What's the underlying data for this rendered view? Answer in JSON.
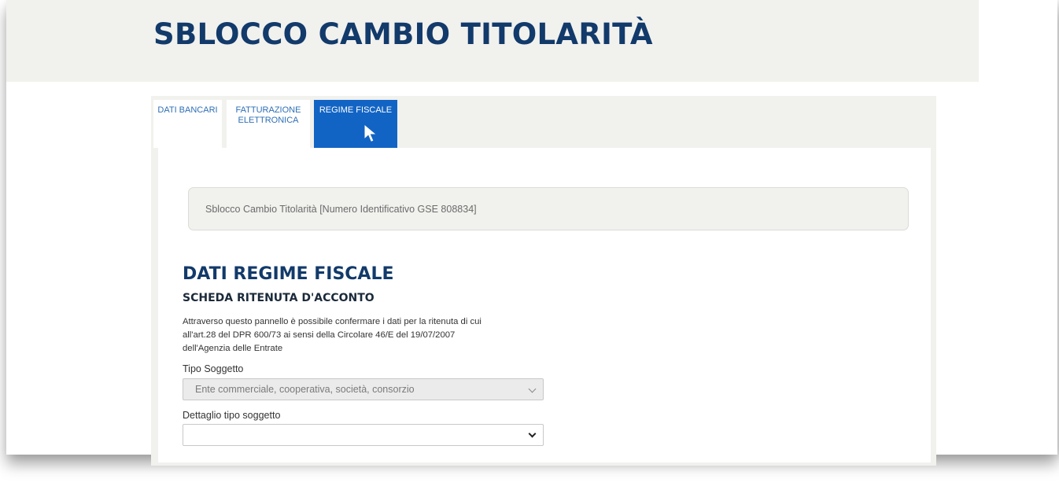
{
  "header": {
    "title": "SBLOCCO CAMBIO TITOLARITÀ"
  },
  "tabs": [
    {
      "label_line1": "DATI BANCARI",
      "label_line2": ""
    },
    {
      "label_line1": "FATTURAZIONE",
      "label_line2": "ELETTRONICA"
    },
    {
      "label_line1": "REGIME FISCALE",
      "label_line2": ""
    }
  ],
  "active_tab": "REGIME FISCALE",
  "info_box": {
    "text": "Sblocco Cambio Titolarità [Numero Identificativo GSE 808834]"
  },
  "section": {
    "title": "DATI REGIME FISCALE",
    "subtitle": "SCHEDA RITENUTA D'ACCONTO",
    "description_lines": [
      "Attraverso questo pannello è possibile confermare i dati per la ritenuta di cui",
      "all'art.28 del DPR 600/73 ai sensi della Circolare 46/E del 19/07/2007",
      "dell'Agenzia delle Entrate"
    ]
  },
  "fields": {
    "tipo_soggetto": {
      "label": "Tipo Soggetto",
      "value": "Ente commerciale, cooperativa, società, consorzio"
    },
    "dettaglio_tipo_soggetto": {
      "label": "Dettaglio tipo soggetto",
      "value": ""
    }
  },
  "colors": {
    "brand_navy": "#123a6a",
    "tab_active": "#1264c4",
    "tab_text": "#2e6fb6",
    "panel_bg": "#f1f1ee"
  },
  "icons": {
    "pointer": "mouse-pointer-icon",
    "dropdown": "chevron-down-icon"
  }
}
